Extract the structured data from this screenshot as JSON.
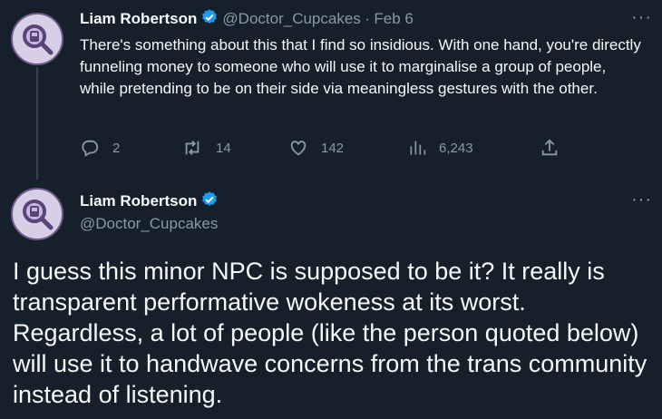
{
  "tweet1": {
    "author_name": "Liam Robertson",
    "handle": "@Doctor_Cupcakes",
    "separator": "·",
    "date": "Feb 6",
    "text": "There's something about this that I find so insidious. With one hand, you're directly funneling money to someone who will use it to marginalise a group of people, while pretending to be on their side via meaningless gestures with the other.",
    "more_label": "···",
    "actions": {
      "replies": "2",
      "retweets": "14",
      "likes": "142",
      "views": "6,243"
    }
  },
  "tweet2": {
    "author_name": "Liam Robertson",
    "handle": "@Doctor_Cupcakes",
    "more_label": "···",
    "text": "I guess this minor NPC is supposed to be it? It really is transparent performative wokeness at its worst. Regardless, a lot of people (like the person quoted below) will use it to handwave concerns from the trans community instead of listening."
  },
  "colors": {
    "background": "#15202b",
    "text": "#f7f9f9",
    "secondary": "#8b98a5",
    "verified": "#1d9bf0",
    "avatar_ring": "#6f5a8a"
  },
  "icons": [
    "reply-icon",
    "retweet-icon",
    "like-icon",
    "views-icon",
    "share-icon",
    "verified-badge-icon",
    "more-icon"
  ]
}
